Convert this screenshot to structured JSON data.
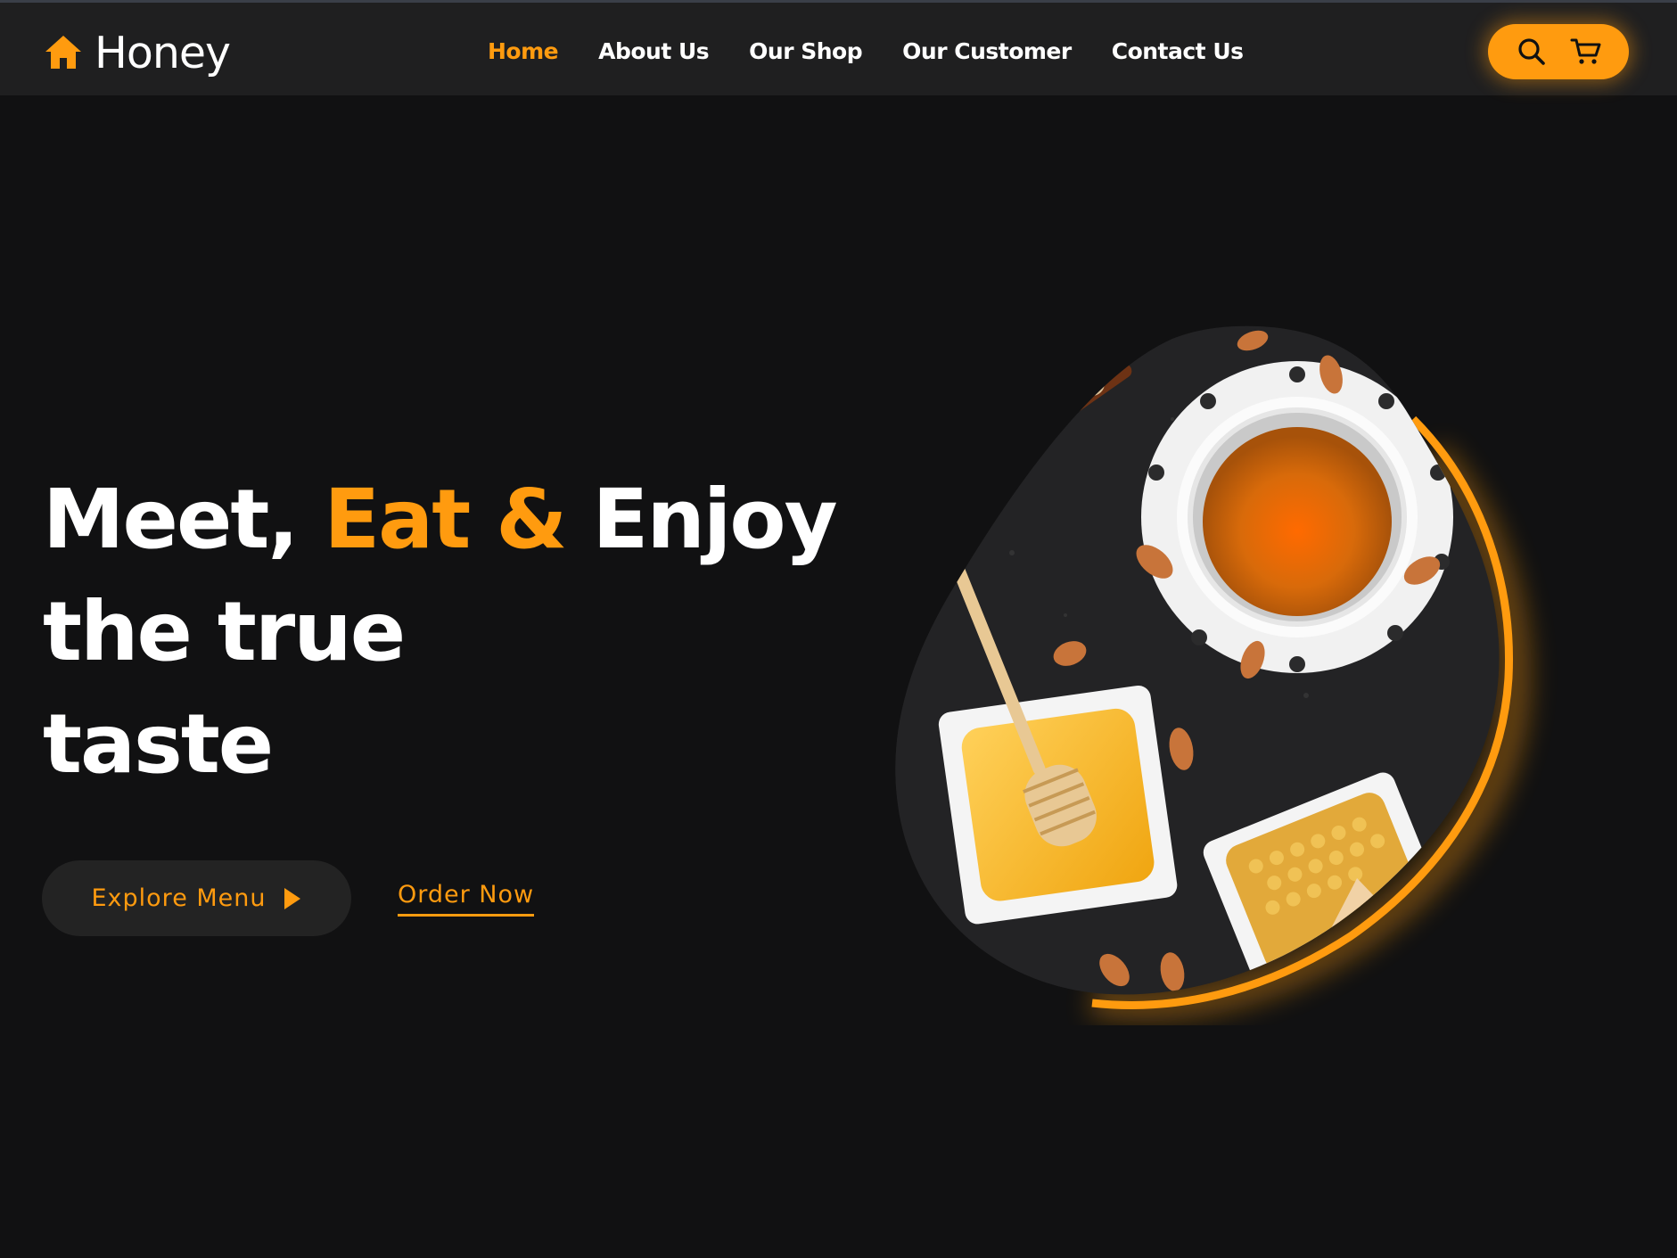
{
  "brand": {
    "name": "Honey",
    "icon": "house-icon"
  },
  "nav": {
    "items": [
      {
        "label": "Home",
        "active": true
      },
      {
        "label": "About Us",
        "active": false
      },
      {
        "label": "Our Shop",
        "active": false
      },
      {
        "label": "Our Customer",
        "active": false
      },
      {
        "label": "Contact Us",
        "active": false
      }
    ]
  },
  "actions": {
    "search_icon": "search-icon",
    "cart_icon": "cart-icon"
  },
  "hero": {
    "title_part1": "Meet, ",
    "title_accent": "Eat &",
    "title_part2": " Enjoy",
    "title_line2": "the true",
    "title_line3": "taste",
    "explore_label": "Explore Menu",
    "order_label": "Order Now",
    "image_icon": "honey-plate-photo"
  },
  "colors": {
    "background": "#111112",
    "navbar": "#1f1f20",
    "accent": "#ff9b0f",
    "text": "#ffffff",
    "button_dark": "#232323"
  }
}
